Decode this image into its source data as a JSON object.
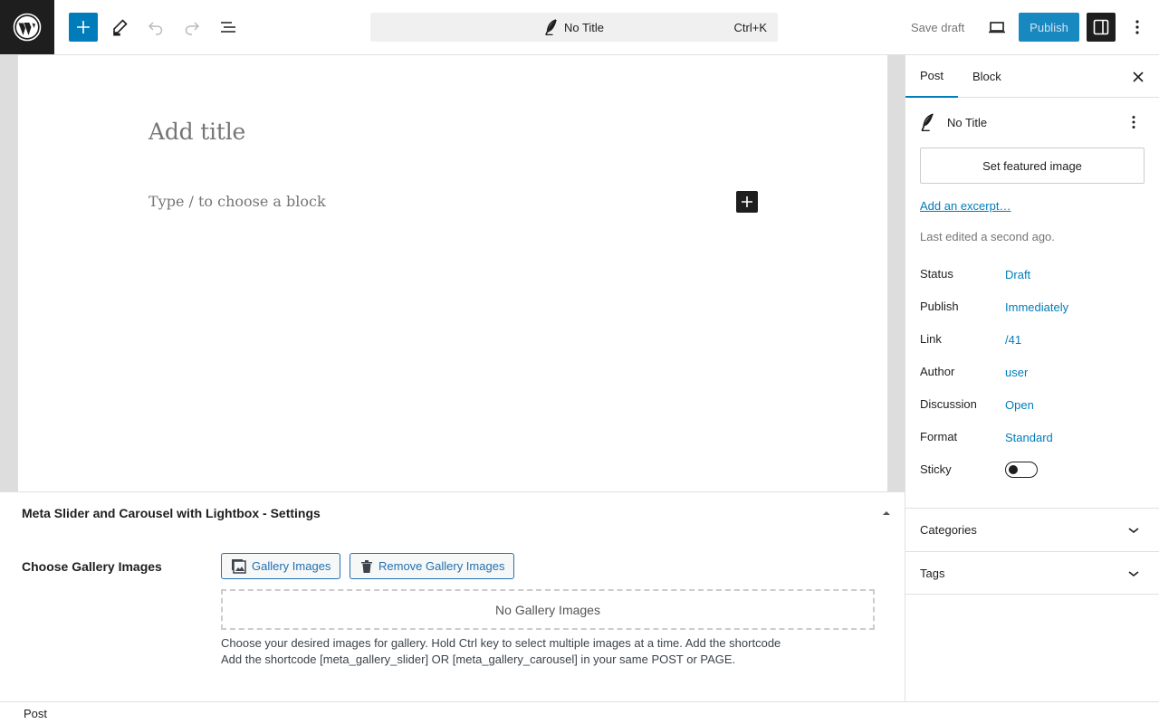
{
  "toolbar": {
    "document_title": "No Title",
    "shortcut": "Ctrl+K",
    "save_draft": "Save draft",
    "publish": "Publish"
  },
  "editor": {
    "title_placeholder": "Add title",
    "block_placeholder": "Type / to choose a block"
  },
  "metabox": {
    "title": "Meta Slider and Carousel with Lightbox - Settings",
    "label": "Choose Gallery Images",
    "gallery_button": "Gallery Images",
    "remove_button": "Remove Gallery Images",
    "empty_text": "No Gallery Images",
    "help_line1": "Choose your desired images for gallery. Hold Ctrl key to select multiple images at a time. Add the shortcode",
    "help_line2": "Add the shortcode [meta_gallery_slider] OR [meta_gallery_carousel] in your same POST or PAGE."
  },
  "sidebar": {
    "tabs": [
      {
        "label": "Post",
        "active": true
      },
      {
        "label": "Block",
        "active": false
      }
    ],
    "post_title": "No Title",
    "featured_image": "Set featured image",
    "excerpt": "Add an excerpt…",
    "last_edited": "Last edited a second ago.",
    "meta": [
      {
        "label": "Status",
        "value": "Draft"
      },
      {
        "label": "Publish",
        "value": "Immediately"
      },
      {
        "label": "Link",
        "value": "/41"
      },
      {
        "label": "Author",
        "value": "user"
      },
      {
        "label": "Discussion",
        "value": "Open"
      },
      {
        "label": "Format",
        "value": "Standard"
      }
    ],
    "sticky_label": "Sticky",
    "sticky_on": false,
    "panels": [
      {
        "label": "Categories"
      },
      {
        "label": "Tags"
      }
    ]
  },
  "footer": {
    "breadcrumb": "Post"
  },
  "colors": {
    "accent": "#007cba",
    "dark": "#1e1e1e"
  }
}
